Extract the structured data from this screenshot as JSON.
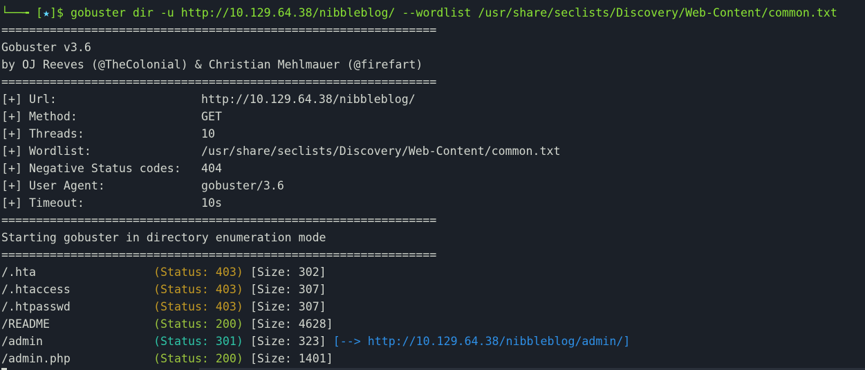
{
  "prompt": {
    "frame": "└──╼ ",
    "open": "[",
    "star": "★",
    "close": "]$ ",
    "command": "gobuster dir -u http://10.129.64.38/nibbleblog/ --wordlist /usr/share/seclists/Discovery/Web-Content/common.txt"
  },
  "separator": "===============================================================",
  "banner": {
    "name": "Gobuster v3.6",
    "authors": "by OJ Reeves (@TheColonial) & Christian Mehlmauer (@firefart)"
  },
  "config": [
    {
      "label": "[+] Url:",
      "value": "http://10.129.64.38/nibbleblog/"
    },
    {
      "label": "[+] Method:",
      "value": "GET"
    },
    {
      "label": "[+] Threads:",
      "value": "10"
    },
    {
      "label": "[+] Wordlist:",
      "value": "/usr/share/seclists/Discovery/Web-Content/common.txt"
    },
    {
      "label": "[+] Negative Status codes:",
      "value": "404"
    },
    {
      "label": "[+] User Agent:",
      "value": "gobuster/3.6"
    },
    {
      "label": "[+] Timeout:",
      "value": "10s"
    }
  ],
  "start_message": "Starting gobuster in directory enumeration mode",
  "results": [
    {
      "path": "/.hta",
      "status": "(Status: 403)",
      "size": "[Size: 302]",
      "redirect": ""
    },
    {
      "path": "/.htaccess",
      "status": "(Status: 403)",
      "size": "[Size: 307]",
      "redirect": ""
    },
    {
      "path": "/.htpasswd",
      "status": "(Status: 403)",
      "size": "[Size: 307]",
      "redirect": ""
    },
    {
      "path": "/README",
      "status": "(Status: 200)",
      "size": "[Size: 4628]",
      "redirect": ""
    },
    {
      "path": "/admin",
      "status": "(Status: 301)",
      "size": "[Size: 323]",
      "redirect": "[--> http://10.129.64.38/nibbleblog/admin/]"
    },
    {
      "path": "/admin.php",
      "status": "(Status: 200)",
      "size": "[Size: 1401]",
      "redirect": ""
    }
  ],
  "colors": {
    "background": "#1b2028",
    "text": "#d3d7cf",
    "prompt": "#8ae234",
    "status_403": "#c49a24",
    "status_200": "#9bc53d",
    "status_301": "#2ec4a6",
    "redirect": "#2e8fe6"
  }
}
